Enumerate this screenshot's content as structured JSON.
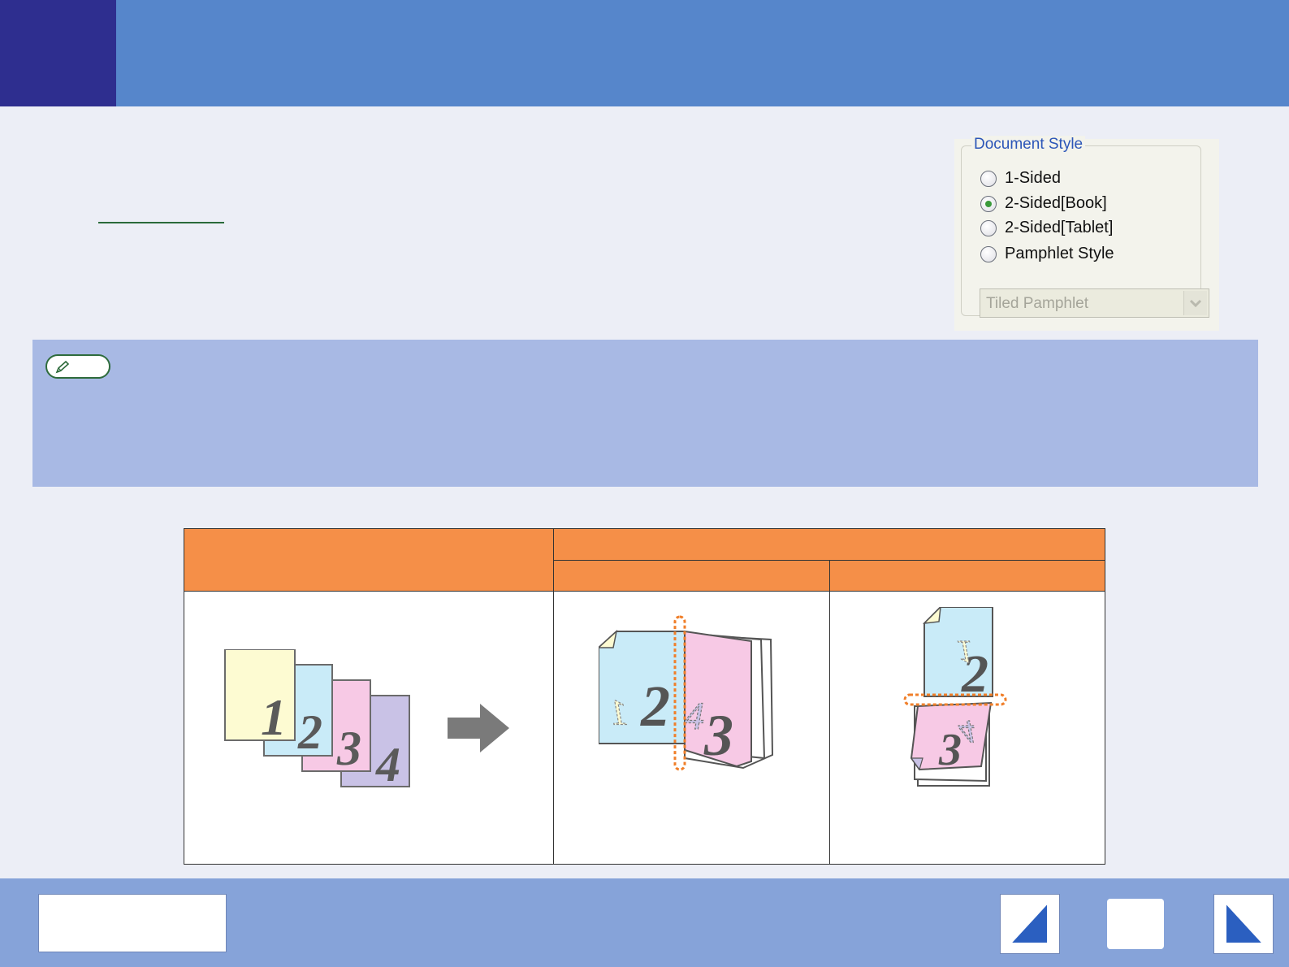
{
  "document_style": {
    "legend": "Document Style",
    "options": [
      {
        "label": "1-Sided",
        "selected": false
      },
      {
        "label": "2-Sided[Book]",
        "selected": true
      },
      {
        "label": "2-Sided[Tablet]",
        "selected": false
      },
      {
        "label": "Pamphlet Style",
        "selected": false
      }
    ],
    "pamphlet_dropdown": {
      "value": "Tiled Pamphlet",
      "enabled": false
    }
  },
  "illustrations": {
    "original_pages": [
      "1",
      "2",
      "3",
      "4"
    ],
    "book_pages": [
      "1",
      "2",
      "4",
      "3"
    ],
    "tablet_pages": [
      "1",
      "2",
      "4",
      "3"
    ]
  },
  "colors": {
    "header": "#5686cb",
    "header_square": "#2e2e8f",
    "note_box": "#a8b9e4",
    "table_header": "#f58f48",
    "footer": "#86a3d9",
    "nav_arrow": "#2b5fc0",
    "binding_marker": "#f07f2a"
  },
  "icons": {
    "note": "pencil-icon",
    "prev": "arrow-left-icon",
    "next": "arrow-right-icon",
    "flow": "arrow-right-icon"
  }
}
